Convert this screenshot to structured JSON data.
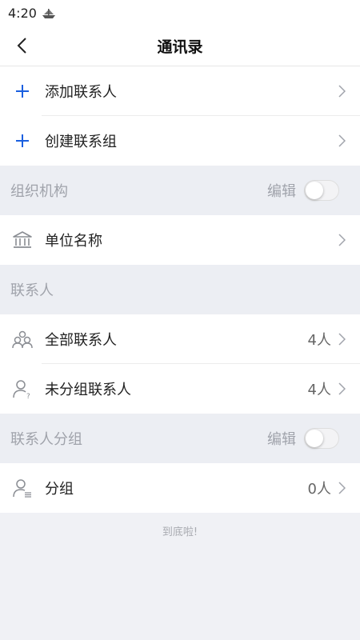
{
  "status": {
    "time": "4:20"
  },
  "nav": {
    "title": "通讯录"
  },
  "actions": [
    {
      "label": "添加联系人"
    },
    {
      "label": "创建联系组"
    }
  ],
  "org_section": {
    "title": "组织机构",
    "edit": "编辑"
  },
  "org_items": [
    {
      "label": "单位名称"
    }
  ],
  "contacts_section": {
    "title": "联系人"
  },
  "contacts": [
    {
      "label": "全部联系人",
      "count": "4人"
    },
    {
      "label": "未分组联系人",
      "count": "4人"
    }
  ],
  "groups_section": {
    "title": "联系人分组",
    "edit": "编辑"
  },
  "groups": [
    {
      "label": "分组",
      "count": "0人"
    }
  ],
  "footer": {
    "text": "到底啦!"
  },
  "colors": {
    "accent": "#1a5fe0",
    "icon_gray": "#8a8d93"
  }
}
